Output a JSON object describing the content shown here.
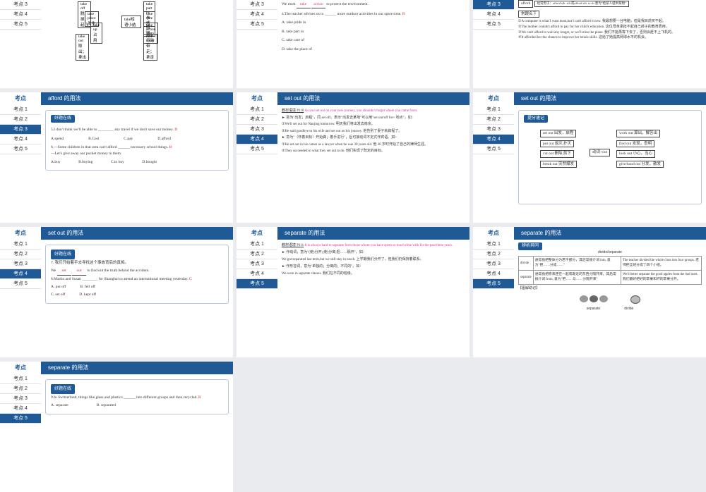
{
  "sidebar": {
    "head": "考点",
    "items": [
      "考点 1",
      "考点 2",
      "考点 3",
      "考点 4",
      "考点 5"
    ]
  },
  "slides": {
    "s1": {
      "labels": [
        "take off 脱掉；起飞",
        "take place 发生",
        "take up 占用",
        "take out 取出；拿出",
        "take短语小结",
        "take part in 参加",
        "take care of 照顾",
        "take action 采取行动",
        "take away 带走；拿走"
      ]
    },
    "s2": {
      "line1": "We must",
      "ans1": "take",
      "ans1b": "action",
      "line1b": "to protect the environment.",
      "q4": "4.The teacher advises us to ______ more outdoor activities in our spare time.",
      "ans4": "B",
      "opts": [
        "A. take pride in",
        "B. take part in",
        "C. take care of",
        "D. take the place of"
      ]
    },
    "s3": {
      "box1": "afford",
      "box2": "经常用于：afford sth. sth.或afford sth. to sb.意为\"给某人提供某物\"",
      "box3": "常跟名下",
      "ex": [
        "①A computer is what I want most,but I can't afford it now. 我最想要一台电脑，但是我目前买不起。",
        "②The mother couldn't afford to pay for her child's education. 这位母亲承担不起自己孩子的教育费用。",
        "③We can't afford to wait any longer, or we'll miss the plane. 我们不能再等下去了，否则会赶不上飞机的。",
        "④It afforded her the chance to improve her tennis skills. 这给了她提高网球水平的机会。"
      ]
    },
    "s4": {
      "title": "afford 的用法",
      "badge": "好题在线",
      "q5": "5.I don't think we'll be able to ________ any travel if we don't save our money.",
      "ans5": "D",
      "opts5": [
        "A.spend",
        "B.Cost",
        "C.pay",
        "D.afford"
      ],
      "q6": "6.—Some children in that area can't afford ______ necessary school things.",
      "q6b": "—Let's give away our pocket money to them.",
      "ans6": "B",
      "opts6": [
        "A.buy",
        "B.buying",
        "C.to buy",
        "D.bought"
      ]
    },
    "s5": {
      "title": "set out 的用法",
      "src": "教材语境 P110",
      "srcText": "As you set out on your new journey, you shouldn't forget where you came from.",
      "p": [
        "► 意为\"出发；启程\"，同 set off。表示\"出发去某地\"可以用\"set out/off for+ 地点\"，如：",
        "①We'll set out for Nanjing tomorrow. 明天我们将出发去南京。",
        "②He said goodbye to his wife and set out on his journey. 他告别了妻子就启程了。",
        "► 意为\"（怀着目标）开始做；着手进行\"，后可接动词不定式作宾语。如：",
        "①He set out in his career as a lawyer when he was 30 years old. 他 30 岁时开始了自己的律师生涯。",
        "②They succeeded in what they set out to do. 他们实现了既定的目标。"
      ]
    },
    "s6": {
      "title": "set out 的用法",
      "badge": "提分速记",
      "left": [
        "set out 出发，启程",
        "put out 熄灭,扑灭",
        "cut out 删除,剪下",
        "break out 突然爆发"
      ],
      "mid": "动词+out",
      "right": [
        "work out 算出，解答出",
        "find out 发现，查明",
        "look out 小心，当心",
        "give/hand out 分发，散发"
      ]
    },
    "s7": {
      "title": "set out 的用法",
      "badge": "好题在线",
      "q7": "7. 我们开始着手去寻找这个事故背后的真相。",
      "q7b": "We ______ ______ to find out the truth behind the accident.",
      "ans7a": "set",
      "ans7b": "out",
      "q8": "8.Martin and Susan ________ for Shanghai to attend an international meeting yesterday.",
      "ans8": "C",
      "opts8": [
        "A. put off",
        "B. fell off",
        "C. set off",
        "D. kept off"
      ]
    },
    "s8": {
      "title": "separate 的用法",
      "src": "教材语境 P111",
      "srcText": "It is always hard to separate from those whom you have spent so much time with for the past three years.",
      "p": [
        "► 作动词，意为\"(使)分开;(使)分离;把……隔开\"。如：",
        "We got separated last term,but we still stay in touch. 上学期我们分开了，但我们仍保持着联系。",
        "► 作形容词，意为\"单独的；分离的；不同的\"。如：",
        "We were in separate classes. 我们在不同的班级。"
      ]
    },
    "s9": {
      "title": "separate 的用法",
      "badge": "辨析异同",
      "tableTitle": "divide/separate",
      "rows": [
        {
          "w": "divide",
          "cn": "通常指把整体分为若干部分，其后常接介词 into, 意为\"把……分成……\"",
          "ex": "The teacher divided the whole class into four groups. 老师把全班分成了四个小组。"
        },
        {
          "w": "separate",
          "cn": "通常指把原来连在一起或靠近的东西分隔开来，其后常接介词 from, 意为\"把……与……分隔开来\"",
          "ex": "We'd better separate the good apples from the bad ones. 我们最好把好的苹果和坏的苹果分开。"
        }
      ],
      "memo": "【图解助记】",
      "cap1": "separate",
      "cap2": "divide"
    },
    "s10": {
      "title": "separate 的用法",
      "badge": "好题在线",
      "q9": "9.In Switzerland, things like glass and plastics ______ into different groups and then recycled.",
      "ans9": "B",
      "opts": [
        "A. separate",
        "B. separated"
      ]
    }
  }
}
